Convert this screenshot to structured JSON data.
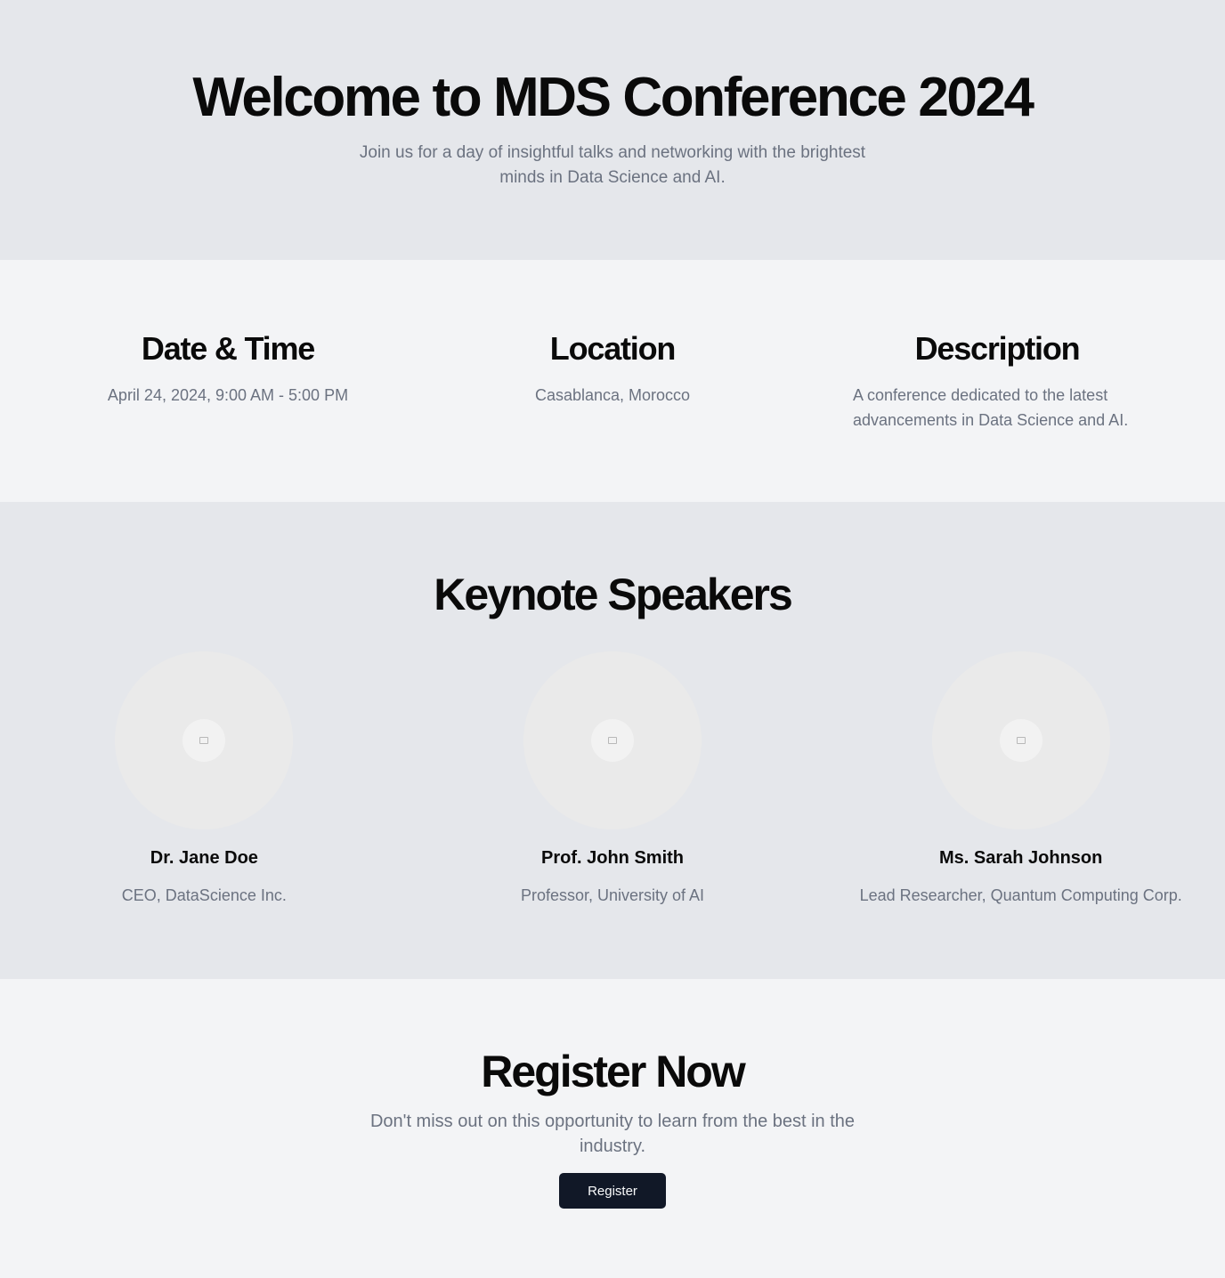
{
  "hero": {
    "title": "Welcome to MDS Conference 2024",
    "subtitle": "Join us for a day of insightful talks and networking with the brightest minds in Data Science and AI."
  },
  "info": [
    {
      "heading": "Date & Time",
      "text": "April 24, 2024, 9:00 AM - 5:00 PM"
    },
    {
      "heading": "Location",
      "text": "Casablanca, Morocco"
    },
    {
      "heading": "Description",
      "text": "A conference dedicated to the latest advancements in Data Science and AI."
    }
  ],
  "speakers": {
    "heading": "Keynote Speakers",
    "items": [
      {
        "name": "Dr. Jane Doe",
        "role": "CEO, DataScience Inc.",
        "icon": "image-placeholder-icon"
      },
      {
        "name": "Prof. John Smith",
        "role": "Professor, University of AI",
        "icon": "image-placeholder-icon"
      },
      {
        "name": "Ms. Sarah Johnson",
        "role": "Lead Researcher, Quantum Computing Corp.",
        "icon": "image-placeholder-icon"
      }
    ]
  },
  "register": {
    "heading": "Register Now",
    "text": "Don't miss out on this opportunity to learn from the best in the industry.",
    "button_label": "Register"
  },
  "colors": {
    "section_dark": "#e5e7eb",
    "section_light": "#f3f4f6",
    "muted_text": "#6b7280",
    "button_bg": "#111827"
  }
}
